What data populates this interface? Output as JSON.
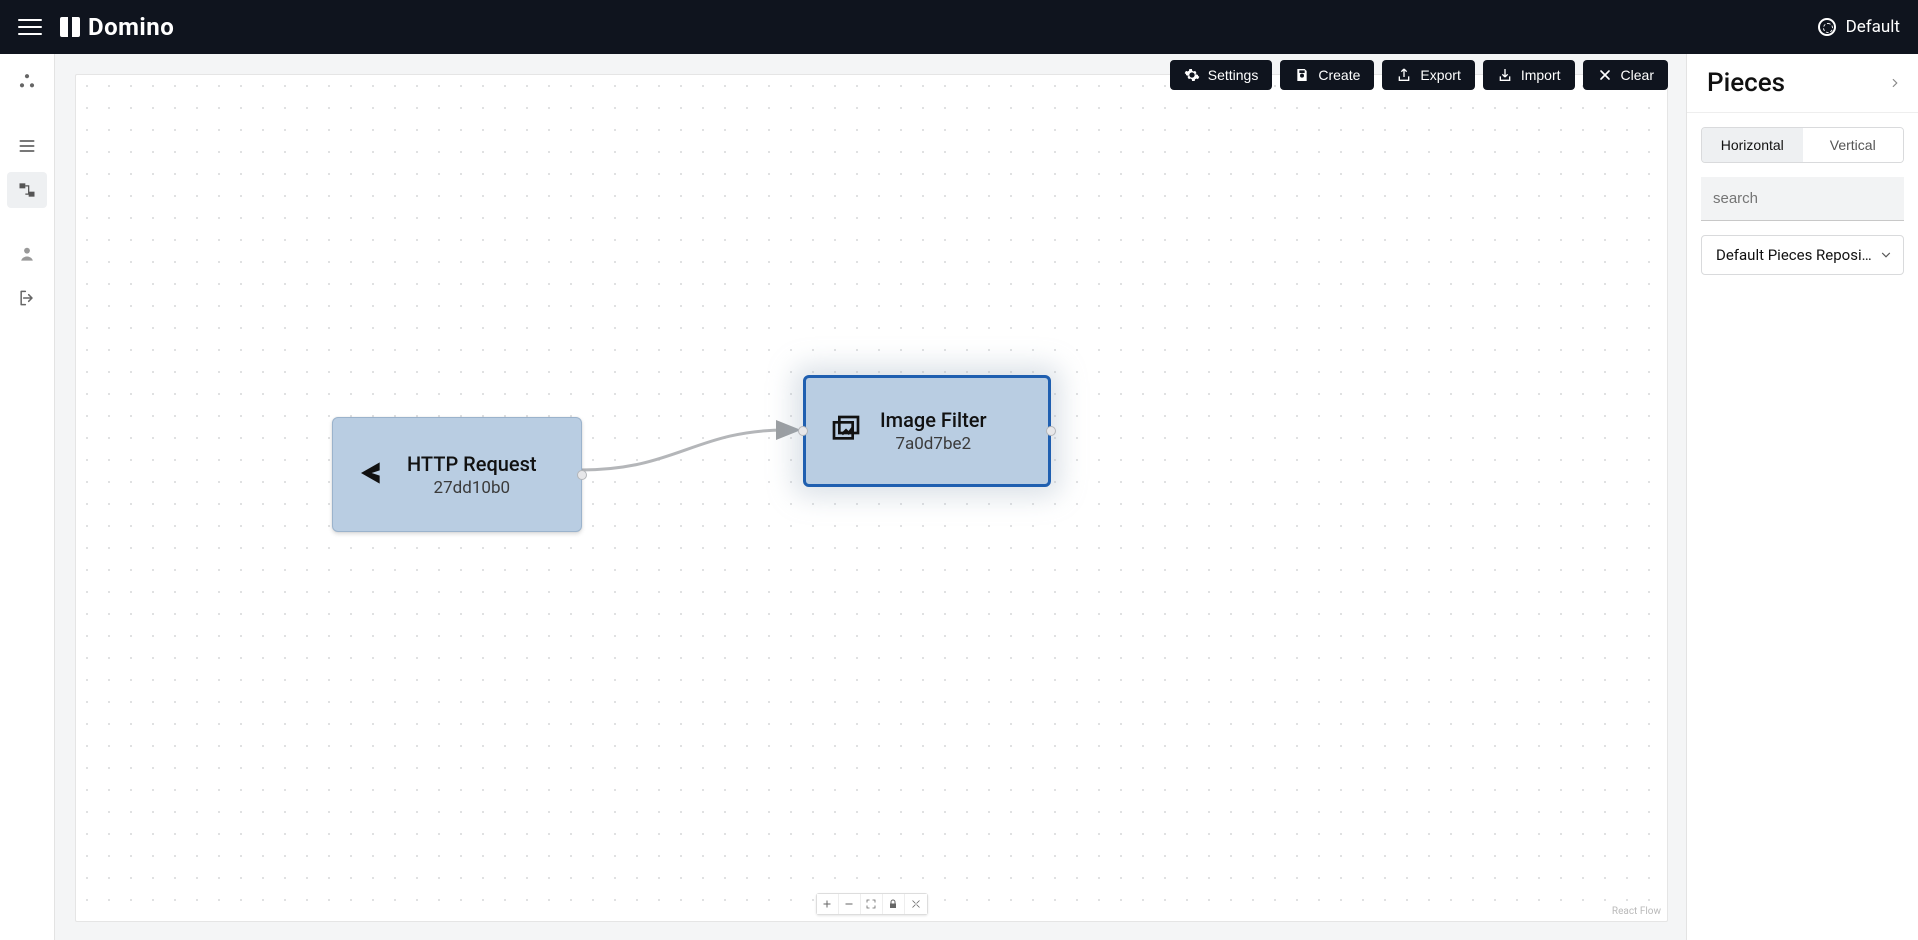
{
  "header": {
    "brand": "Domino",
    "workspace_label": "Default"
  },
  "toolbar": {
    "settings": "Settings",
    "create": "Create",
    "export": "Export",
    "import": "Import",
    "clear": "Clear"
  },
  "canvas": {
    "attribution": "React Flow",
    "nodes": [
      {
        "title": "HTTP Request",
        "id_label": "27dd10b0"
      },
      {
        "title": "Image Filter",
        "id_label": "7a0d7be2"
      }
    ]
  },
  "panel": {
    "title": "Pieces",
    "orientation": {
      "horizontal": "Horizontal",
      "vertical": "Vertical"
    },
    "search_placeholder": "search",
    "repo_selected": "Default Pieces Reposit…"
  }
}
